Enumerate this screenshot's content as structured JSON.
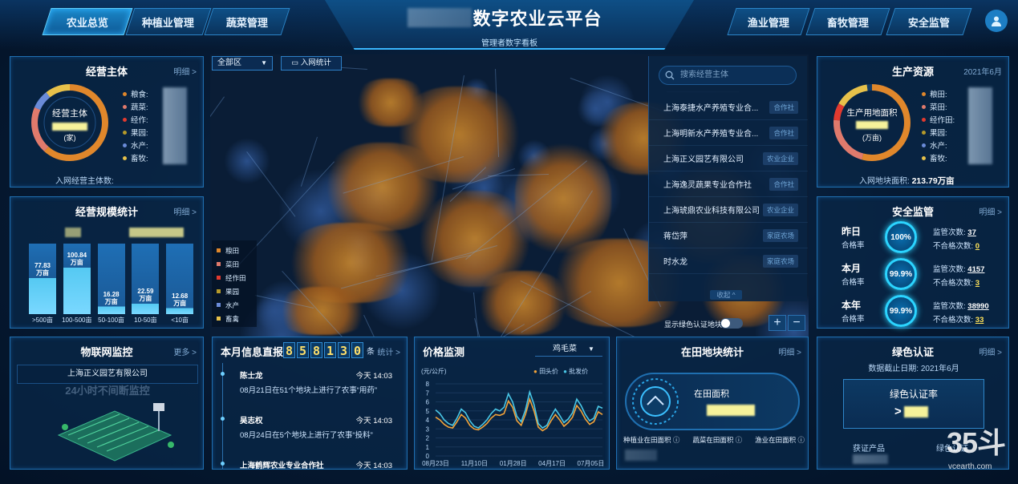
{
  "header": {
    "tabs_left": [
      "农业总览",
      "种植业管理",
      "蔬菜管理"
    ],
    "tabs_right": [
      "渔业管理",
      "畜牧管理",
      "安全监管"
    ],
    "title": "数字农业云平台",
    "subtitle": "管理者数字看板"
  },
  "entity_panel": {
    "title": "经营主体",
    "more": "明细 >",
    "center_label": "经营主体",
    "center_unit": "(家)",
    "legend": [
      "粮食:",
      "蔬菜:",
      "经作:",
      "果园:",
      "水产:",
      "畜牧:"
    ],
    "footer": "入网经营主体数:",
    "colors": [
      "#e0872b",
      "#e07a6c",
      "#e23a2f",
      "#b59a2a",
      "#6a8bd8",
      "#e7c14a"
    ]
  },
  "scale_panel": {
    "title": "经营规模统计",
    "more": "明细 >",
    "chart_data": {
      "type": "bar",
      "categories": [
        ">500亩",
        "100-500亩",
        "50-100亩",
        "10-50亩",
        "<10亩"
      ],
      "values": [
        77.83,
        100.84,
        16.28,
        22.59,
        12.68
      ],
      "value_labels": [
        "77.83\n万亩",
        "100.84\n万亩",
        "16.28\n万亩",
        "22.59\n万亩",
        "12.68\n万亩"
      ]
    }
  },
  "map": {
    "region_select": "全部区",
    "net_stat_btn": "入网统计",
    "legend": [
      "粮田",
      "菜田",
      "经作田",
      "果园",
      "水产",
      "畜禽"
    ],
    "legend_colors": [
      "#e0872b",
      "#e07a6c",
      "#e23a2f",
      "#b59a2a",
      "#6a8bd8",
      "#e7c14a"
    ],
    "search_placeholder": "搜索经营主体",
    "list": [
      {
        "name": "上海泰捷水产养殖专业合...",
        "tag": "合作社"
      },
      {
        "name": "上海明新水产养殖专业合...",
        "tag": "合作社"
      },
      {
        "name": "上海正义园艺有限公司",
        "tag": "农业企业"
      },
      {
        "name": "上海逸灵蔬果专业合作社",
        "tag": "合作社"
      },
      {
        "name": "上海琥鼎农业科技有限公司",
        "tag": "农业企业"
      },
      {
        "name": "蒋岱萍",
        "tag": "家庭农场"
      },
      {
        "name": "时水龙",
        "tag": "家庭农场"
      }
    ],
    "collapse": "收起 ^",
    "toggle_label": "显示绿色认证地块",
    "zoom_in": "+",
    "zoom_out": "−"
  },
  "resource_panel": {
    "title": "生产资源",
    "date": "2021年6月",
    "center_label": "生产用地面积",
    "center_unit": "(万亩)",
    "legend": [
      "粮田:",
      "菜田:",
      "经作田:",
      "果园:",
      "水产:",
      "畜牧:"
    ],
    "footer_label": "入网地块面积:",
    "footer_value": "213.79万亩"
  },
  "safety_panel": {
    "title": "安全监管",
    "more": "明细 >",
    "rows": [
      {
        "period": "昨日",
        "label": "合格率",
        "rate": "100%",
        "checks_label": "监管次数:",
        "checks": "37",
        "fail_label": "不合格次数:",
        "fail": "0"
      },
      {
        "period": "本月",
        "label": "合格率",
        "rate": "99.9%",
        "checks_label": "监管次数:",
        "checks": "4157",
        "fail_label": "不合格次数:",
        "fail": "3"
      },
      {
        "period": "本年",
        "label": "合格率",
        "rate": "99.9%",
        "checks_label": "监管次数:",
        "checks": "38990",
        "fail_label": "不合格次数:",
        "fail": "33"
      }
    ]
  },
  "iot_panel": {
    "title": "物联网监控",
    "more": "更多 >",
    "company": "上海正义园艺有限公司",
    "caption": "24小时不间断监控"
  },
  "news_panel": {
    "title": "本月信息直报",
    "digits": [
      "8",
      "5",
      "8",
      "1",
      "3",
      "0"
    ],
    "unit": "条",
    "more": "统计 >",
    "items": [
      {
        "name": "陈士龙",
        "time": "今天 14:03",
        "text": "08月21日在51个地块上进行了农事“用药”"
      },
      {
        "name": "吴志权",
        "time": "今天 14:03",
        "text": "08月24日在5个地块上进行了农事“投料”"
      },
      {
        "name": "上海鹤辉农业专业合作社",
        "time": "今天 14:03",
        "text": ""
      }
    ]
  },
  "price_panel": {
    "title": "价格监测",
    "select": "鸡毛菜",
    "unit": "(元/公斤)",
    "chart_data": {
      "type": "line",
      "ylim": [
        0,
        8
      ],
      "yticks": [
        0,
        1,
        2,
        3,
        4,
        5,
        6,
        7,
        8
      ],
      "xticks": [
        "08月23日",
        "11月10日",
        "01月28日",
        "04月17日",
        "07月05日"
      ],
      "series": [
        {
          "name": "田头价",
          "color": "#f2a33a",
          "values": [
            4.3,
            4.0,
            3.5,
            3.2,
            3.1,
            3.8,
            4.6,
            4.2,
            3.4,
            3.0,
            2.9,
            3.2,
            3.6,
            4.2,
            4.6,
            4.5,
            4.7,
            6.1,
            5.4,
            3.9,
            3.4,
            4.6,
            6.3,
            5.0,
            3.2,
            2.8,
            3.1,
            3.9,
            4.6,
            4.0,
            3.3,
            3.7,
            4.3,
            5.6,
            5.0,
            4.1,
            3.5,
            3.8,
            4.9,
            4.6
          ]
        },
        {
          "name": "批发价",
          "color": "#49c7e6",
          "values": [
            5.1,
            4.7,
            4.0,
            3.6,
            3.4,
            4.2,
            5.2,
            4.8,
            3.9,
            3.3,
            3.1,
            3.5,
            4.0,
            4.7,
            5.2,
            5.0,
            5.4,
            6.9,
            6.0,
            4.4,
            3.8,
            5.1,
            7.1,
            5.7,
            3.6,
            3.1,
            3.4,
            4.4,
            5.2,
            4.5,
            3.7,
            4.1,
            4.8,
            6.3,
            5.6,
            4.6,
            3.9,
            4.2,
            5.5,
            5.3
          ]
        }
      ]
    }
  },
  "field_panel": {
    "title": "在田地块统计",
    "more": "明细 >",
    "center": "在田面积",
    "items": [
      "种植业在田面积",
      "蔬菜在田面积",
      "渔业在田面积"
    ]
  },
  "green_panel": {
    "title": "绿色认证",
    "more": "明细 >",
    "date": "数据截止日期: 2021年6月",
    "rate_label": "绿色认证率",
    "rate_prefix": ">",
    "bottom_left": "获证产品",
    "bottom_right": "绿色认证"
  },
  "watermark": {
    "big": "35斗",
    "small": "vcearth.com"
  }
}
